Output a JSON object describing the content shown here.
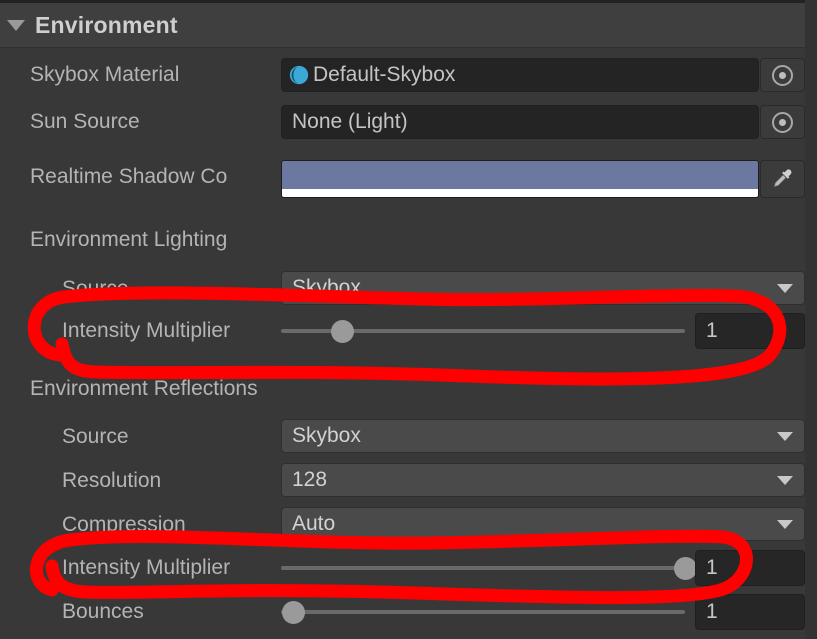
{
  "panel": {
    "header": {
      "title": "Environment",
      "foldout_icon": "triangle-down-icon",
      "expanded": true
    },
    "accent_colors": {
      "panel_background": "#383838",
      "header_background": "#3f3f3f",
      "label_text": "#b4b4b4",
      "value_text": "#c8c8c8",
      "dropdown_background": "#4a4a4a",
      "field_background": "#242424",
      "slider_track": "#6a6a6a",
      "slider_handle": "#9a9a9a",
      "annotation_red": "#ff0000",
      "shadow_color_swatch": "#6b789f",
      "material_icon_blue": "#3ca8d8"
    },
    "rows": [
      {
        "id": "skybox-material",
        "label": "Skybox Material",
        "indent": 0,
        "type": "object-field",
        "value": "Default-Skybox",
        "icon": "material-sphere-icon",
        "picker_icon": "circle-select-icon"
      },
      {
        "id": "sun-source",
        "label": "Sun Source",
        "indent": 0,
        "type": "object-field",
        "value": "None (Light)",
        "icon": null,
        "picker_icon": "circle-select-icon"
      },
      {
        "id": "realtime-shadow-color",
        "label": "Realtime Shadow Co",
        "label_full": "Realtime Shadow Color",
        "indent": 0,
        "type": "color-field",
        "value": "#6b789f",
        "alpha_value": "#ffffff",
        "picker_icon": "eyedropper-icon"
      },
      {
        "id": "environment-lighting-section",
        "label": "Environment Lighting",
        "indent": 0,
        "type": "section-header"
      },
      {
        "id": "env-lighting-source",
        "label": "Source",
        "indent": 1,
        "type": "dropdown",
        "value": "Skybox",
        "arrow_icon": "chevron-down-icon"
      },
      {
        "id": "env-lighting-intensity-multiplier",
        "label": "Intensity Multiplier",
        "indent": 1,
        "type": "slider",
        "value": "1",
        "handle_percent": 15,
        "annotated": true
      },
      {
        "id": "environment-reflections-section",
        "label": "Environment Reflections",
        "indent": 0,
        "type": "section-header"
      },
      {
        "id": "env-reflections-source",
        "label": "Source",
        "indent": 1,
        "type": "dropdown",
        "value": "Skybox",
        "arrow_icon": "chevron-down-icon"
      },
      {
        "id": "env-reflections-resolution",
        "label": "Resolution",
        "indent": 1,
        "type": "dropdown",
        "value": "128",
        "arrow_icon": "chevron-down-icon"
      },
      {
        "id": "env-reflections-compression",
        "label": "Compression",
        "indent": 1,
        "type": "dropdown",
        "value": "Auto",
        "arrow_icon": "chevron-down-icon"
      },
      {
        "id": "env-reflections-intensity-multiplier",
        "label": "Intensity Multiplier",
        "indent": 1,
        "type": "slider",
        "value": "1",
        "handle_percent": 100,
        "annotated": true
      },
      {
        "id": "env-reflections-bounces",
        "label": "Bounces",
        "indent": 1,
        "type": "slider",
        "value": "1",
        "handle_percent": 3,
        "annotated": false
      }
    ],
    "annotations": [
      {
        "id": "annotation-lighting-intensity",
        "shape": "hand-drawn-ellipse",
        "color": "#ff0000",
        "targets": "env-lighting-intensity-multiplier"
      },
      {
        "id": "annotation-reflections-intensity",
        "shape": "hand-drawn-ellipse",
        "color": "#ff0000",
        "targets": "env-reflections-intensity-multiplier"
      }
    ]
  }
}
